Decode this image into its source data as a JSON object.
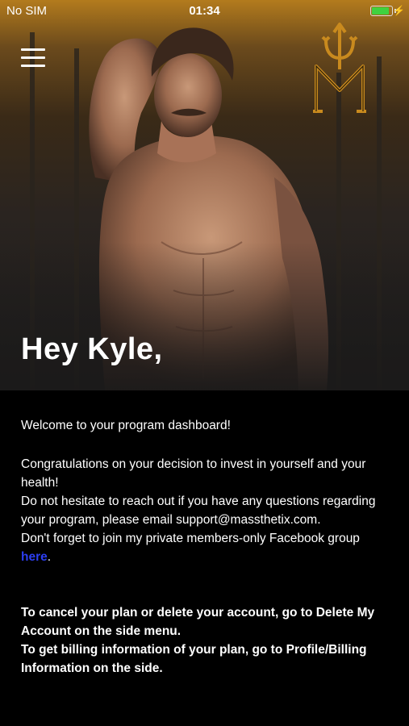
{
  "status_bar": {
    "carrier": "No SIM",
    "time": "01:34",
    "battery_level": 0.9,
    "battery_color": "#3fd13f"
  },
  "header": {
    "menu_icon": "hamburger-menu-icon",
    "logo_icon": "trident-m-logo"
  },
  "hero": {
    "greeting": "Hey Kyle,"
  },
  "message": {
    "welcome": "Welcome to your program dashboard!",
    "line1": "Congratulations on your decision to invest in yourself and your health!",
    "line2": "Do not hesitate to reach out if you have any questions regarding your program, please email support@massthetix.com.",
    "line3": "Don't forget to join my private members-only Facebook group ",
    "link_label": "here",
    "link_suffix": ".",
    "cancel_note": "To cancel your plan or delete your account, go to Delete My Account on the side menu.",
    "billing_note": "To get billing information of your plan, go to Profile/Billing Information on the side."
  },
  "colors": {
    "accent": "#c98a1e",
    "link": "#2c3ef0"
  }
}
